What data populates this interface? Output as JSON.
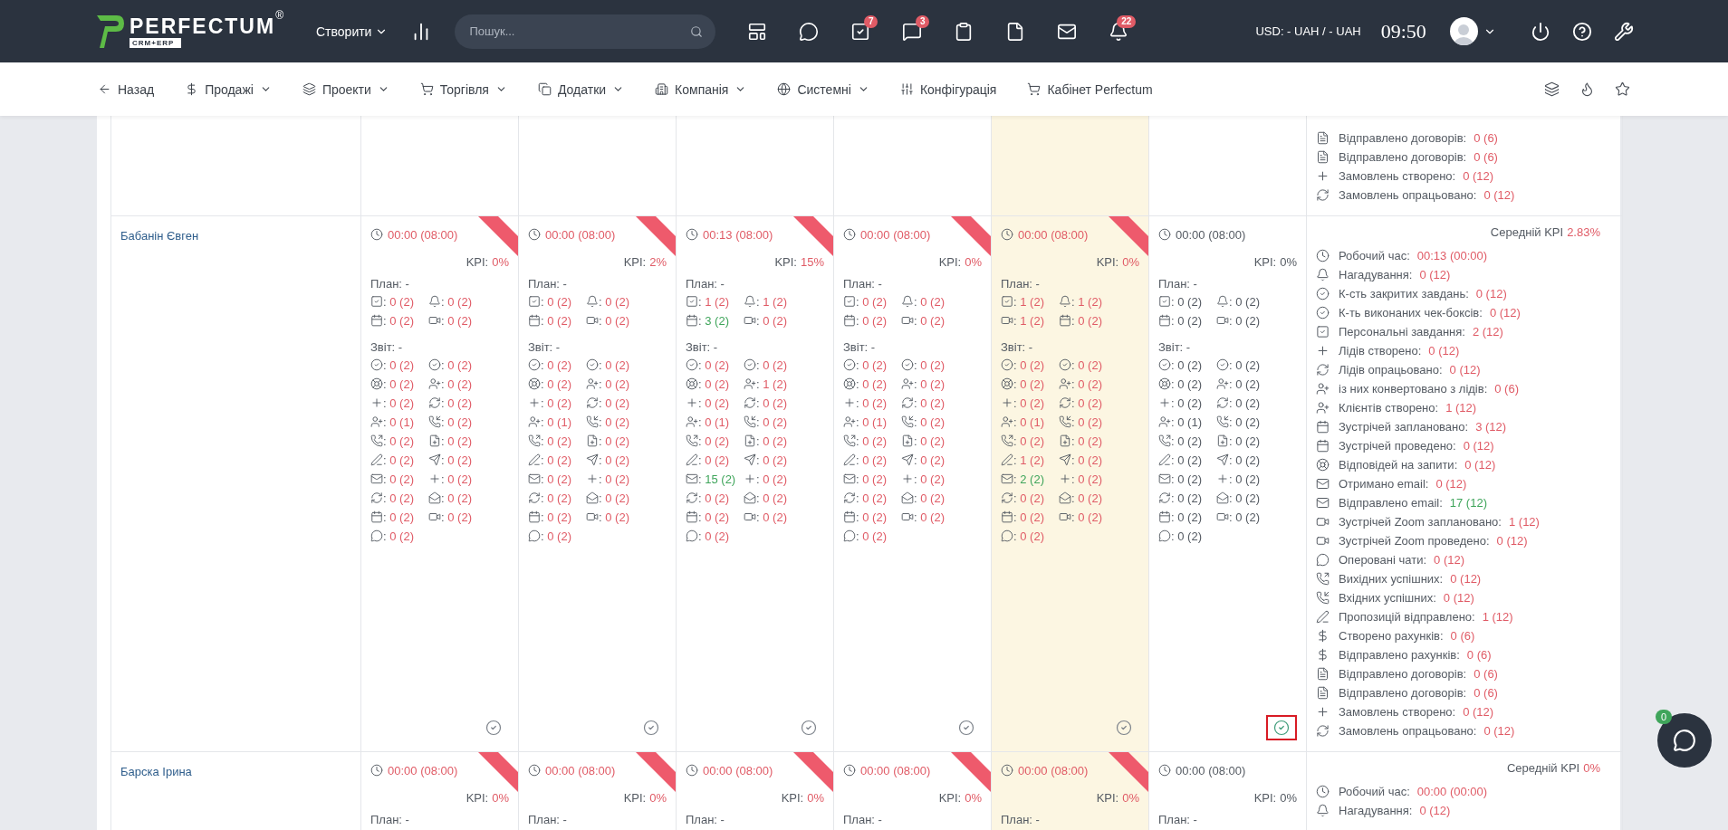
{
  "topbar": {
    "logo": {
      "name": "PERFECTUM",
      "mark": "®",
      "badge": "CRM+ERP"
    },
    "create": "Створити",
    "search": {
      "placeholder": "Пошук..."
    },
    "icons": [
      {
        "kind": "layout"
      },
      {
        "kind": "chat"
      },
      {
        "kind": "task",
        "badge": "7"
      },
      {
        "kind": "message",
        "badge": "3"
      },
      {
        "kind": "clipboard"
      },
      {
        "kind": "file"
      },
      {
        "kind": "mail"
      },
      {
        "kind": "bell",
        "badge": "22"
      }
    ],
    "currency": "USD: - UAH / - UAH",
    "time": "09:50"
  },
  "nav": {
    "items": [
      {
        "label": "Назад",
        "kind": "back",
        "dropdown": false
      },
      {
        "label": "Продажі",
        "kind": "dollar",
        "dropdown": true
      },
      {
        "label": "Проекти",
        "kind": "layers",
        "dropdown": true
      },
      {
        "label": "Торгівля",
        "kind": "cart",
        "dropdown": true
      },
      {
        "label": "Додатки",
        "kind": "copy",
        "dropdown": true
      },
      {
        "label": "Компанія",
        "kind": "building",
        "dropdown": true
      },
      {
        "label": "Системні",
        "kind": "globe",
        "dropdown": true
      },
      {
        "label": "Конфігурація",
        "kind": "sliders",
        "dropdown": false
      },
      {
        "label": "Кабінет Perfectum",
        "kind": "cart",
        "dropdown": false
      }
    ],
    "right_icons": [
      {
        "kind": "layers"
      },
      {
        "kind": "flame"
      },
      {
        "kind": "star"
      }
    ]
  },
  "rows": [
    {
      "days": [
        {
          "today": false
        },
        {
          "today": false
        },
        {
          "today": false
        },
        {
          "today": false
        },
        {
          "today": true
        },
        {
          "today": false
        }
      ],
      "summary": {
        "lines": [
          {
            "kind": "file",
            "label": "Відправлено договорів:",
            "value": "0 (6)",
            "color": "#e05b66"
          },
          {
            "kind": "file",
            "label": "Відправлено договорів:",
            "value": "0 (6)",
            "color": "#e05b66"
          },
          {
            "kind": "plus",
            "label": "Замовлень створено:",
            "value": "0 (12)",
            "color": "#e05b66"
          },
          {
            "kind": "refresh",
            "label": "Замовлень опрацьовано:",
            "value": "0 (12)",
            "color": "#e05b66"
          }
        ]
      }
    },
    {
      "name": "Бабанін Євген",
      "days": [
        {
          "today": false,
          "flagged": true,
          "time": "00:00 (08:00)",
          "color": "#e05b66",
          "kpi_label": "KPI:",
          "kpi": "0%",
          "plan_label": "План: -",
          "report_label": "Звіт: -",
          "marked": false,
          "plan": [
            {
              "kind": "task",
              "value": ": 0 (2)",
              "color": "#e05b66"
            },
            {
              "kind": "bell",
              "value": ": 0 (2)",
              "color": "#e05b66"
            },
            {
              "kind": "calendar",
              "value": ": 0 (2)",
              "color": "#e05b66"
            },
            {
              "kind": "video",
              "value": ": 0 (2)",
              "color": "#e05b66"
            }
          ],
          "report": [
            {
              "kind": "check-circle",
              "value": ": 0 (2)",
              "color": "#e05b66"
            },
            {
              "kind": "check-circle",
              "value": ": 0 (2)",
              "color": "#e05b66"
            },
            {
              "kind": "lifebuoy",
              "value": ": 0 (2)",
              "color": "#e05b66"
            },
            {
              "kind": "user-plus",
              "value": ": 0 (2)",
              "color": "#e05b66"
            },
            {
              "kind": "plus",
              "value": ": 0 (2)",
              "color": "#e05b66"
            },
            {
              "kind": "refresh",
              "value": ": 0 (2)",
              "color": "#e05b66"
            },
            {
              "kind": "user-plus",
              "value": ": 0 (1)",
              "color": "#e05b66"
            },
            {
              "kind": "phone-in",
              "value": ": 0 (2)",
              "color": "#e05b66"
            },
            {
              "kind": "phone-out",
              "value": ": 0 (2)",
              "color": "#e05b66"
            },
            {
              "kind": "file-plus",
              "value": ": 0 (2)",
              "color": "#e05b66"
            },
            {
              "kind": "pen",
              "value": ": 0 (2)",
              "color": "#e05b66"
            },
            {
              "kind": "send",
              "value": ": 0 (2)",
              "color": "#e05b66"
            },
            {
              "kind": "mail",
              "value": ": 0 (2)",
              "color": "#e05b66"
            },
            {
              "kind": "plus",
              "value": ": 0 (2)",
              "color": "#e05b66"
            },
            {
              "kind": "refresh",
              "value": ": 0 (2)",
              "color": "#e05b66"
            },
            {
              "kind": "mail-open",
              "value": ": 0 (2)",
              "color": "#e05b66"
            },
            {
              "kind": "calendar",
              "value": ": 0 (2)",
              "color": "#e05b66"
            },
            {
              "kind": "video",
              "value": ": 0 (2)",
              "color": "#e05b66"
            },
            {
              "kind": "chat",
              "value": ": 0 (2)",
              "color": "#e05b66"
            }
          ]
        },
        {
          "today": false,
          "flagged": true,
          "time": "00:00 (08:00)",
          "color": "#e05b66",
          "kpi_label": "KPI:",
          "kpi": "2%",
          "plan_label": "План: -",
          "report_label": "Звіт: -",
          "marked": false,
          "plan": [
            {
              "kind": "task",
              "value": ": 0 (2)",
              "color": "#e05b66"
            },
            {
              "kind": "bell",
              "value": ": 0 (2)",
              "color": "#e05b66"
            },
            {
              "kind": "calendar",
              "value": ": 0 (2)",
              "color": "#e05b66"
            },
            {
              "kind": "video",
              "value": ": 0 (2)",
              "color": "#e05b66"
            }
          ],
          "report": [
            {
              "kind": "check-circle",
              "value": ": 0 (2)",
              "color": "#e05b66"
            },
            {
              "kind": "check-circle",
              "value": ": 0 (2)",
              "color": "#e05b66"
            },
            {
              "kind": "lifebuoy",
              "value": ": 0 (2)",
              "color": "#e05b66"
            },
            {
              "kind": "user-plus",
              "value": ": 0 (2)",
              "color": "#e05b66"
            },
            {
              "kind": "plus",
              "value": ": 0 (2)",
              "color": "#e05b66"
            },
            {
              "kind": "refresh",
              "value": ": 0 (2)",
              "color": "#e05b66"
            },
            {
              "kind": "user-plus",
              "value": ": 0 (1)",
              "color": "#e05b66"
            },
            {
              "kind": "phone-in",
              "value": ": 0 (2)",
              "color": "#e05b66"
            },
            {
              "kind": "phone-out",
              "value": ": 0 (2)",
              "color": "#e05b66"
            },
            {
              "kind": "file-plus",
              "value": ": 0 (2)",
              "color": "#e05b66"
            },
            {
              "kind": "pen",
              "value": ": 0 (2)",
              "color": "#e05b66"
            },
            {
              "kind": "send",
              "value": ": 0 (2)",
              "color": "#e05b66"
            },
            {
              "kind": "mail",
              "value": ": 0 (2)",
              "color": "#e05b66"
            },
            {
              "kind": "plus",
              "value": ": 0 (2)",
              "color": "#e05b66"
            },
            {
              "kind": "refresh",
              "value": ": 0 (2)",
              "color": "#e05b66"
            },
            {
              "kind": "mail-open",
              "value": ": 0 (2)",
              "color": "#e05b66"
            },
            {
              "kind": "calendar",
              "value": ": 0 (2)",
              "color": "#e05b66"
            },
            {
              "kind": "video",
              "value": ": 0 (2)",
              "color": "#e05b66"
            },
            {
              "kind": "chat",
              "value": ": 0 (2)",
              "color": "#e05b66"
            }
          ]
        },
        {
          "today": false,
          "flagged": true,
          "time": "00:13 (08:00)",
          "color": "#e05b66",
          "kpi_label": "KPI:",
          "kpi": "15%",
          "plan_label": "План: -",
          "report_label": "Звіт: -",
          "marked": false,
          "plan": [
            {
              "kind": "task",
              "value": ": 1 (2)",
              "color": "#e05b66"
            },
            {
              "kind": "bell",
              "value": ": 1 (2)",
              "color": "#e05b66"
            },
            {
              "kind": "calendar",
              "value": ": 3 (2)",
              "color": "#3fa55b"
            },
            {
              "kind": "video",
              "value": ": 0 (2)",
              "color": "#e05b66"
            }
          ],
          "report": [
            {
              "kind": "check-circle",
              "value": ": 0 (2)",
              "color": "#e05b66"
            },
            {
              "kind": "check-circle",
              "value": ": 0 (2)",
              "color": "#e05b66"
            },
            {
              "kind": "lifebuoy",
              "value": ": 0 (2)",
              "color": "#e05b66"
            },
            {
              "kind": "user-plus",
              "value": ": 1 (2)",
              "color": "#e05b66"
            },
            {
              "kind": "plus",
              "value": ": 0 (2)",
              "color": "#e05b66"
            },
            {
              "kind": "refresh",
              "value": ": 0 (2)",
              "color": "#e05b66"
            },
            {
              "kind": "user-plus",
              "value": ": 0 (1)",
              "color": "#e05b66"
            },
            {
              "kind": "phone-in",
              "value": ": 0 (2)",
              "color": "#e05b66"
            },
            {
              "kind": "phone-out",
              "value": ": 0 (2)",
              "color": "#e05b66"
            },
            {
              "kind": "file-plus",
              "value": ": 0 (2)",
              "color": "#e05b66"
            },
            {
              "kind": "pen",
              "value": ": 0 (2)",
              "color": "#e05b66"
            },
            {
              "kind": "send",
              "value": ": 0 (2)",
              "color": "#e05b66"
            },
            {
              "kind": "mail",
              "value": ": 15 (2)",
              "color": "#3fa55b"
            },
            {
              "kind": "plus",
              "value": ": 0 (2)",
              "color": "#e05b66"
            },
            {
              "kind": "refresh",
              "value": ": 0 (2)",
              "color": "#e05b66"
            },
            {
              "kind": "mail-open",
              "value": ": 0 (2)",
              "color": "#e05b66"
            },
            {
              "kind": "calendar",
              "value": ": 0 (2)",
              "color": "#e05b66"
            },
            {
              "kind": "video",
              "value": ": 0 (2)",
              "color": "#e05b66"
            },
            {
              "kind": "chat",
              "value": ": 0 (2)",
              "color": "#e05b66"
            }
          ]
        },
        {
          "today": false,
          "flagged": true,
          "time": "00:00 (08:00)",
          "color": "#e05b66",
          "kpi_label": "KPI:",
          "kpi": "0%",
          "plan_label": "План: -",
          "report_label": "Звіт: -",
          "marked": false,
          "plan": [
            {
              "kind": "task",
              "value": ": 0 (2)",
              "color": "#e05b66"
            },
            {
              "kind": "bell",
              "value": ": 0 (2)",
              "color": "#e05b66"
            },
            {
              "kind": "calendar",
              "value": ": 0 (2)",
              "color": "#e05b66"
            },
            {
              "kind": "video",
              "value": ": 0 (2)",
              "color": "#e05b66"
            }
          ],
          "report": [
            {
              "kind": "check-circle",
              "value": ": 0 (2)",
              "color": "#e05b66"
            },
            {
              "kind": "check-circle",
              "value": ": 0 (2)",
              "color": "#e05b66"
            },
            {
              "kind": "lifebuoy",
              "value": ": 0 (2)",
              "color": "#e05b66"
            },
            {
              "kind": "user-plus",
              "value": ": 0 (2)",
              "color": "#e05b66"
            },
            {
              "kind": "plus",
              "value": ": 0 (2)",
              "color": "#e05b66"
            },
            {
              "kind": "refresh",
              "value": ": 0 (2)",
              "color": "#e05b66"
            },
            {
              "kind": "user-plus",
              "value": ": 0 (1)",
              "color": "#e05b66"
            },
            {
              "kind": "phone-in",
              "value": ": 0 (2)",
              "color": "#e05b66"
            },
            {
              "kind": "phone-out",
              "value": ": 0 (2)",
              "color": "#e05b66"
            },
            {
              "kind": "file-plus",
              "value": ": 0 (2)",
              "color": "#e05b66"
            },
            {
              "kind": "pen",
              "value": ": 0 (2)",
              "color": "#e05b66"
            },
            {
              "kind": "send",
              "value": ": 0 (2)",
              "color": "#e05b66"
            },
            {
              "kind": "mail",
              "value": ": 0 (2)",
              "color": "#e05b66"
            },
            {
              "kind": "plus",
              "value": ": 0 (2)",
              "color": "#e05b66"
            },
            {
              "kind": "refresh",
              "value": ": 0 (2)",
              "color": "#e05b66"
            },
            {
              "kind": "mail-open",
              "value": ": 0 (2)",
              "color": "#e05b66"
            },
            {
              "kind": "calendar",
              "value": ": 0 (2)",
              "color": "#e05b66"
            },
            {
              "kind": "video",
              "value": ": 0 (2)",
              "color": "#e05b66"
            },
            {
              "kind": "chat",
              "value": ": 0 (2)",
              "color": "#e05b66"
            }
          ]
        },
        {
          "today": true,
          "flagged": true,
          "time": "00:00 (08:00)",
          "color": "#e05b66",
          "kpi_label": "KPI:",
          "kpi": "0%",
          "plan_label": "План: -",
          "report_label": "Звіт: -",
          "marked": false,
          "plan": [
            {
              "kind": "task",
              "value": ": 1 (2)",
              "color": "#e05b66"
            },
            {
              "kind": "bell",
              "value": ": 1 (2)",
              "color": "#e05b66"
            },
            {
              "kind": "video",
              "value": ": 1 (2)",
              "color": "#e05b66"
            },
            {
              "kind": "calendar",
              "value": ": 0 (2)",
              "color": "#e05b66"
            }
          ],
          "report": [
            {
              "kind": "check-circle",
              "value": ": 0 (2)",
              "color": "#e05b66"
            },
            {
              "kind": "check-circle",
              "value": ": 0 (2)",
              "color": "#e05b66"
            },
            {
              "kind": "lifebuoy",
              "value": ": 0 (2)",
              "color": "#e05b66"
            },
            {
              "kind": "user-plus",
              "value": ": 0 (2)",
              "color": "#e05b66"
            },
            {
              "kind": "plus",
              "value": ": 0 (2)",
              "color": "#e05b66"
            },
            {
              "kind": "refresh",
              "value": ": 0 (2)",
              "color": "#e05b66"
            },
            {
              "kind": "user-plus",
              "value": ": 0 (1)",
              "color": "#e05b66"
            },
            {
              "kind": "phone-in",
              "value": ": 0 (2)",
              "color": "#e05b66"
            },
            {
              "kind": "phone-out",
              "value": ": 0 (2)",
              "color": "#e05b66"
            },
            {
              "kind": "file-plus",
              "value": ": 0 (2)",
              "color": "#e05b66"
            },
            {
              "kind": "pen",
              "value": ": 1 (2)",
              "color": "#e05b66"
            },
            {
              "kind": "send",
              "value": ": 0 (2)",
              "color": "#e05b66"
            },
            {
              "kind": "mail",
              "value": ": 2 (2)",
              "color": "#3fa55b"
            },
            {
              "kind": "plus",
              "value": ": 0 (2)",
              "color": "#e05b66"
            },
            {
              "kind": "refresh",
              "value": ": 0 (2)",
              "color": "#e05b66"
            },
            {
              "kind": "mail-open",
              "value": ": 0 (2)",
              "color": "#e05b66"
            },
            {
              "kind": "calendar",
              "value": ": 0 (2)",
              "color": "#e05b66"
            },
            {
              "kind": "video",
              "value": ": 0 (2)",
              "color": "#e05b66"
            },
            {
              "kind": "chat",
              "value": ": 0 (2)",
              "color": "#e05b66"
            }
          ]
        },
        {
          "today": false,
          "flagged": false,
          "time": "00:00 (08:00)",
          "color": "#555b63",
          "kpi_label": "KPI:",
          "kpi": "0%",
          "plan_label": "План: -",
          "report_label": "Звіт: -",
          "marked": true,
          "plan": [
            {
              "kind": "task",
              "value": ": 0 (2)",
              "color": "#555b63"
            },
            {
              "kind": "bell",
              "value": ": 0 (2)",
              "color": "#555b63"
            },
            {
              "kind": "calendar",
              "value": ": 0 (2)",
              "color": "#555b63"
            },
            {
              "kind": "video",
              "value": ": 0 (2)",
              "color": "#555b63"
            }
          ],
          "report": [
            {
              "kind": "check-circle",
              "value": ": 0 (2)",
              "color": "#555b63"
            },
            {
              "kind": "check-circle",
              "value": ": 0 (2)",
              "color": "#555b63"
            },
            {
              "kind": "lifebuoy",
              "value": ": 0 (2)",
              "color": "#555b63"
            },
            {
              "kind": "user-plus",
              "value": ": 0 (2)",
              "color": "#555b63"
            },
            {
              "kind": "plus",
              "value": ": 0 (2)",
              "color": "#555b63"
            },
            {
              "kind": "refresh",
              "value": ": 0 (2)",
              "color": "#555b63"
            },
            {
              "kind": "user-plus",
              "value": ": 0 (1)",
              "color": "#555b63"
            },
            {
              "kind": "phone-in",
              "value": ": 0 (2)",
              "color": "#555b63"
            },
            {
              "kind": "phone-out",
              "value": ": 0 (2)",
              "color": "#555b63"
            },
            {
              "kind": "file-plus",
              "value": ": 0 (2)",
              "color": "#555b63"
            },
            {
              "kind": "pen",
              "value": ": 0 (2)",
              "color": "#555b63"
            },
            {
              "kind": "send",
              "value": ": 0 (2)",
              "color": "#555b63"
            },
            {
              "kind": "mail",
              "value": ": 0 (2)",
              "color": "#555b63"
            },
            {
              "kind": "plus",
              "value": ": 0 (2)",
              "color": "#555b63"
            },
            {
              "kind": "refresh",
              "value": ": 0 (2)",
              "color": "#555b63"
            },
            {
              "kind": "mail-open",
              "value": ": 0 (2)",
              "color": "#555b63"
            },
            {
              "kind": "calendar",
              "value": ": 0 (2)",
              "color": "#555b63"
            },
            {
              "kind": "video",
              "value": ": 0 (2)",
              "color": "#555b63"
            },
            {
              "kind": "chat",
              "value": ": 0 (2)",
              "color": "#555b63"
            }
          ]
        }
      ],
      "summary": {
        "kpi_label": "Середній KPI",
        "kpi": "2.83%",
        "color": "#e05b66",
        "lines": [
          {
            "kind": "clock",
            "label": "Робочий час:",
            "value": "00:13 (00:00)",
            "color": "#e05b66"
          },
          {
            "kind": "bell",
            "label": "Нагадування:",
            "value": "0 (12)",
            "color": "#e05b66"
          },
          {
            "kind": "check-circle",
            "label": "К-сть закритих завдань:",
            "value": "0 (12)",
            "color": "#e05b66"
          },
          {
            "kind": "check-circle",
            "label": "К-ть виконаних чек-боксів:",
            "value": "0 (12)",
            "color": "#e05b66"
          },
          {
            "kind": "task",
            "label": "Персональні завдання:",
            "value": "2 (12)",
            "color": "#e05b66"
          },
          {
            "kind": "plus",
            "label": "Лідів створено:",
            "value": "0 (12)",
            "color": "#e05b66"
          },
          {
            "kind": "refresh",
            "label": "Лідів опрацьовано:",
            "value": "0 (12)",
            "color": "#e05b66"
          },
          {
            "kind": "user-plus",
            "label": "із них конвертовано з лідів:",
            "value": "0 (6)",
            "color": "#e05b66"
          },
          {
            "kind": "user-plus",
            "label": "Клієнтів створено:",
            "value": "1 (12)",
            "color": "#e05b66"
          },
          {
            "kind": "calendar",
            "label": "Зустрічей заплановано:",
            "value": "3 (12)",
            "color": "#e05b66"
          },
          {
            "kind": "calendar",
            "label": "Зустрічей проведено:",
            "value": "0 (12)",
            "color": "#e05b66"
          },
          {
            "kind": "lifebuoy",
            "label": "Відповідей на запити:",
            "value": "0 (12)",
            "color": "#e05b66"
          },
          {
            "kind": "mail",
            "label": "Отримано email:",
            "value": "0 (12)",
            "color": "#e05b66"
          },
          {
            "kind": "mail",
            "label": "Відправлено email:",
            "value": "17 (12)",
            "color": "#3fa55b"
          },
          {
            "kind": "video",
            "label": "Зустрічей Zoom заплановано:",
            "value": "1 (12)",
            "color": "#e05b66"
          },
          {
            "kind": "video",
            "label": "Зустрічей Zoom проведено:",
            "value": "0 (12)",
            "color": "#e05b66"
          },
          {
            "kind": "chat",
            "label": "Оперовані чати:",
            "value": "0 (12)",
            "color": "#e05b66"
          },
          {
            "kind": "phone-out",
            "label": "Вихідних успішних:",
            "value": "0 (12)",
            "color": "#e05b66"
          },
          {
            "kind": "phone-in",
            "label": "Вхідних успішних:",
            "value": "0 (12)",
            "color": "#e05b66"
          },
          {
            "kind": "pen",
            "label": "Пропозицій відправлено:",
            "value": "1 (12)",
            "color": "#e05b66"
          },
          {
            "kind": "dollar",
            "label": "Створено рахунків:",
            "value": "0 (6)",
            "color": "#e05b66"
          },
          {
            "kind": "dollar",
            "label": "Відправлено рахунків:",
            "value": "0 (6)",
            "color": "#e05b66"
          },
          {
            "kind": "file",
            "label": "Відправлено договорів:",
            "value": "0 (6)",
            "color": "#e05b66"
          },
          {
            "kind": "file",
            "label": "Відправлено договорів:",
            "value": "0 (6)",
            "color": "#e05b66"
          },
          {
            "kind": "plus",
            "label": "Замовлень створено:",
            "value": "0 (12)",
            "color": "#e05b66"
          },
          {
            "kind": "refresh",
            "label": "Замовлень опрацьовано:",
            "value": "0 (12)",
            "color": "#e05b66"
          }
        ]
      }
    },
    {
      "name": "Барска Ірина",
      "days": [
        {
          "today": false,
          "flagged": true,
          "time": "00:00 (08:00)",
          "color": "#e05b66",
          "kpi_label": "KPI:",
          "kpi": "0%",
          "plan_label": "План: -"
        },
        {
          "today": false,
          "flagged": true,
          "time": "00:00 (08:00)",
          "color": "#e05b66",
          "kpi_label": "KPI:",
          "kpi": "0%",
          "plan_label": "План: -"
        },
        {
          "today": false,
          "flagged": true,
          "time": "00:00 (08:00)",
          "color": "#e05b66",
          "kpi_label": "KPI:",
          "kpi": "0%",
          "plan_label": "План: -"
        },
        {
          "today": false,
          "flagged": true,
          "time": "00:00 (08:00)",
          "color": "#e05b66",
          "kpi_label": "KPI:",
          "kpi": "0%",
          "plan_label": "План: -"
        },
        {
          "today": true,
          "flagged": true,
          "time": "00:00 (08:00)",
          "color": "#e05b66",
          "kpi_label": "KPI:",
          "kpi": "0%",
          "plan_label": "План: -"
        },
        {
          "today": false,
          "flagged": false,
          "time": "00:00 (08:00)",
          "color": "#555b63",
          "kpi_label": "KPI:",
          "kpi": "0%",
          "plan_label": "План: -"
        }
      ],
      "summary": {
        "kpi_label": "Середній KPI",
        "kpi": "0%",
        "color": "#e05b66",
        "lines": [
          {
            "kind": "clock",
            "label": "Робочий час:",
            "value": "00:00 (00:00)",
            "color": "#e05b66"
          },
          {
            "kind": "bell",
            "label": "Нагадування:",
            "value": "0 (12)",
            "color": "#e05b66"
          }
        ]
      }
    }
  ],
  "chat_widget": {
    "badge": "0"
  }
}
